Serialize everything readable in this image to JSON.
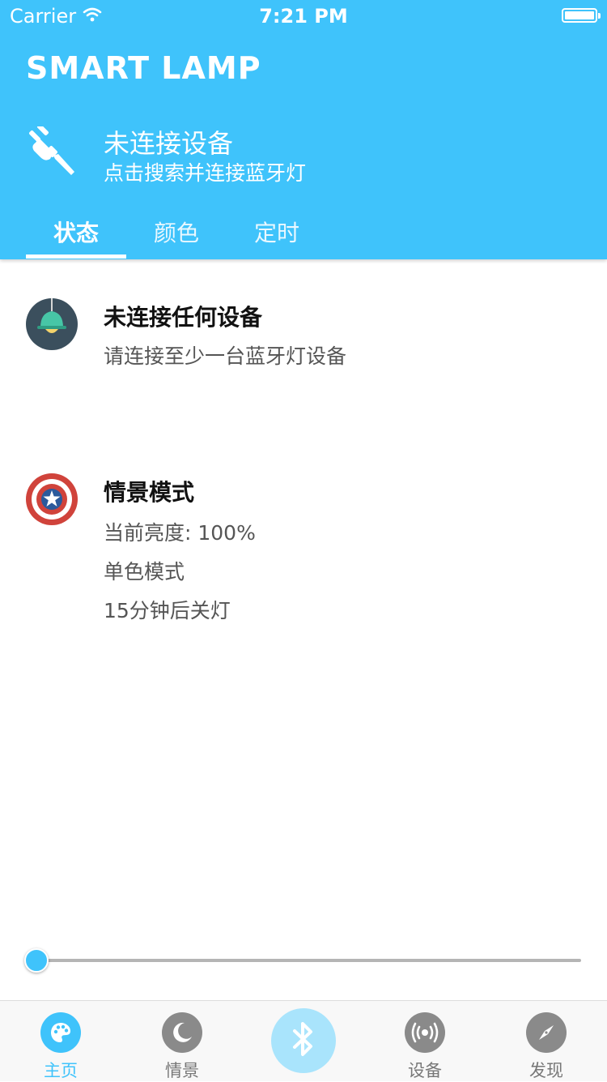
{
  "status_bar": {
    "carrier": "Carrier",
    "time": "7:21 PM"
  },
  "header": {
    "title": "SMART LAMP",
    "connection_title": "未连接设备",
    "connection_subtitle": "点击搜索并连接蓝牙灯"
  },
  "tabs": [
    {
      "label": "状态",
      "active": true
    },
    {
      "label": "颜色",
      "active": false
    },
    {
      "label": "定时",
      "active": false
    }
  ],
  "device_card": {
    "title": "未连接任何设备",
    "subtitle": "请连接至少一台蓝牙灯设备",
    "icon": "lamp-icon"
  },
  "scene_card": {
    "title": "情景模式",
    "brightness": "当前亮度: 100%",
    "mode": "单色模式",
    "timer": "15分钟后关灯",
    "icon": "shield-icon"
  },
  "brightness_slider": {
    "value_fraction": 0.0
  },
  "tabbar": {
    "items": [
      {
        "label": "主页",
        "icon": "palette-icon",
        "active": true
      },
      {
        "label": "情景",
        "icon": "moon-icon",
        "active": false
      },
      {
        "label": "",
        "icon": "bluetooth-icon",
        "active": false
      },
      {
        "label": "设备",
        "icon": "broadcast-icon",
        "active": false
      },
      {
        "label": "发现",
        "icon": "compass-icon",
        "active": false
      }
    ]
  },
  "colors": {
    "primary": "#3fc3fb",
    "bluetooth_button": "#a9e4fc",
    "inactive_icon": "#8a8a8a"
  }
}
